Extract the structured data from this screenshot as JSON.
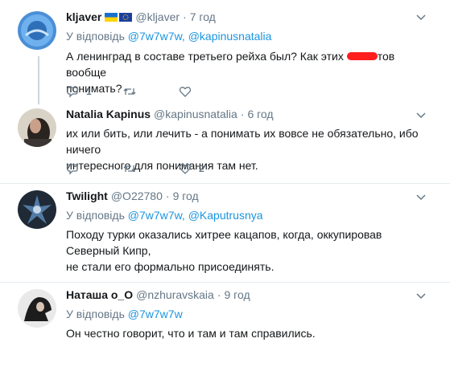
{
  "tweets": [
    {
      "name": "kljaver",
      "handle": "@kljaver",
      "time": "7 год",
      "reply_prefix": "У відповідь",
      "mentions": [
        "@7w7w7w,",
        "@kapinusnatalia"
      ],
      "text_before": "А ленинград в составе третьего рейха был? Как этих",
      "text_after": "тов вообще",
      "text_line2": "понимать?",
      "replies": "1",
      "retweets": "",
      "likes": "",
      "flags": [
        "ukraine-flag-icon",
        "eu-flag-icon"
      ]
    },
    {
      "name": "Natalia Kapinus",
      "handle": "@kapinusnatalia",
      "time": "6 год",
      "text_line1": "их или бить, или лечить - а понимать их вовсе не обязательно, ибо ничего",
      "text_line2": "интересного для понимания там нет.",
      "replies": "",
      "retweets": "",
      "likes": "2"
    },
    {
      "name": "Twilight",
      "handle": "@O22780",
      "time": "9 год",
      "reply_prefix": "У відповідь",
      "mentions": [
        "@7w7w7w,",
        "@Kaputrusnya"
      ],
      "text_line1": "Походу турки оказались хитрее кацапов, когда, оккупировав Северный Кипр,",
      "text_line2": "не стали его формально присоединять."
    },
    {
      "name": "Наташа о_О",
      "handle": "@nzhuravskaia",
      "time": "9 год",
      "reply_prefix": "У відповідь",
      "mentions": [
        "@7w7w7w"
      ],
      "text_line1": "Он честно говорит, что и там и там справились."
    }
  ],
  "dot": "·",
  "colors": {
    "mention": "#1b95e0",
    "secondary": "#657786",
    "redact": "#ff1e1e",
    "line": "#ccd6dd"
  }
}
